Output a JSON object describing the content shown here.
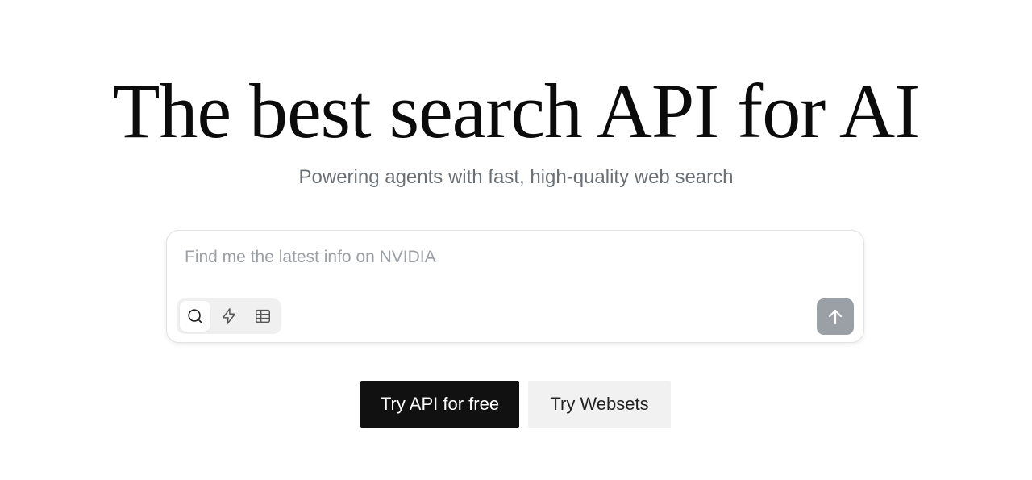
{
  "hero": {
    "title": "The best search API for AI",
    "subtitle": "Powering agents with fast, high-quality web search"
  },
  "search": {
    "placeholder": "Find me the latest info on NVIDIA",
    "value": "",
    "modes": [
      {
        "icon": "search-icon",
        "active": true
      },
      {
        "icon": "lightning-icon",
        "active": false
      },
      {
        "icon": "table-icon",
        "active": false
      }
    ],
    "submit_icon": "arrow-up-icon"
  },
  "cta": {
    "primary_label": "Try API for free",
    "secondary_label": "Try Websets"
  },
  "colors": {
    "primary_button": "#111111",
    "secondary_button": "#f1f1f1",
    "submit_button": "#9aa0a6"
  }
}
